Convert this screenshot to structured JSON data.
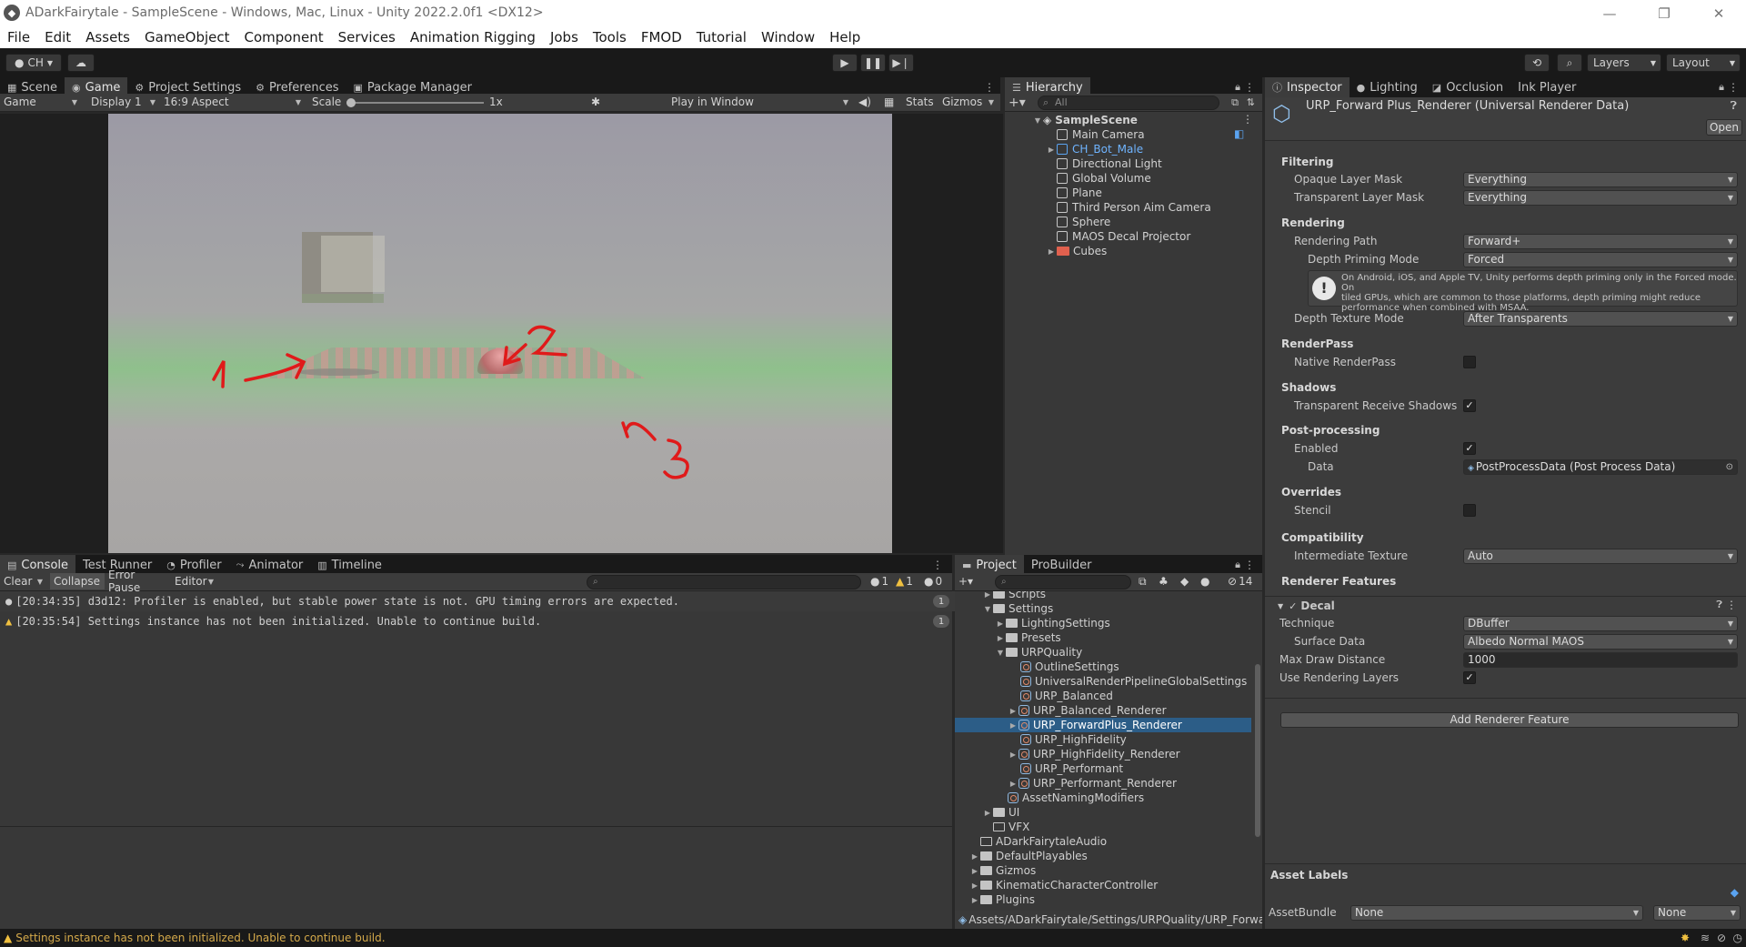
{
  "window": {
    "title": "ADarkFairytale - SampleScene - Windows, Mac, Linux - Unity 2022.2.0f1 <DX12>",
    "controls": [
      "—",
      "❐",
      "✕"
    ]
  },
  "menu": [
    "File",
    "Edit",
    "Assets",
    "GameObject",
    "Component",
    "Services",
    "Animation Rigging",
    "Jobs",
    "Tools",
    "FMOD",
    "Tutorial",
    "Window",
    "Help"
  ],
  "toolbar": {
    "account": "CH",
    "layers": "Layers",
    "layout": "Layout"
  },
  "left_tabs": [
    "Scene",
    "Game",
    "Project Settings",
    "Preferences",
    "Package Manager"
  ],
  "game_toolbar": {
    "mode": "Game",
    "display": "Display 1",
    "aspect": "16:9 Aspect",
    "scale_label": "Scale",
    "scale_value": "1x",
    "play_mode": "Play in Window",
    "stats": "Stats",
    "gizmos": "Gizmos"
  },
  "annotations": [
    "1",
    "2",
    "3"
  ],
  "hierarchy": {
    "tab": "Hierarchy",
    "search_placeholder": "All",
    "scene": "SampleScene",
    "items": [
      "Main Camera",
      "CH_Bot_Male",
      "Directional Light",
      "Global Volume",
      "Plane",
      "Third Person Aim Camera",
      "Sphere",
      "MAOS Decal Projector",
      "Cubes"
    ]
  },
  "inspector": {
    "tabs": [
      "Inspector",
      "Lighting",
      "Occlusion",
      "Ink Player"
    ],
    "title": "URP_Forward Plus_Renderer (Universal Renderer Data)",
    "open_button": "Open",
    "filtering": "Filtering",
    "opaque_label": "Opaque Layer Mask",
    "opaque_value": "Everything",
    "transparent_label": "Transparent Layer Mask",
    "transparent_value": "Everything",
    "rendering": "Rendering",
    "rendering_path_label": "Rendering Path",
    "rendering_path_value": "Forward+",
    "depth_priming_label": "Depth Priming Mode",
    "depth_priming_value": "Forced",
    "info_line1": "On Android, iOS, and Apple TV, Unity performs depth priming only in the Forced mode. On",
    "info_line2": "tiled GPUs, which are common to those platforms, depth priming might reduce",
    "info_line3": "performance when combined with MSAA.",
    "depth_texture_label": "Depth Texture Mode",
    "depth_texture_value": "After Transparents",
    "renderpass": "RenderPass",
    "native_renderpass": "Native RenderPass",
    "shadows": "Shadows",
    "transparent_receive": "Transparent Receive Shadows",
    "post_processing": "Post-processing",
    "enabled": "Enabled",
    "data_label": "Data",
    "data_value": "PostProcessData (Post Process Data)",
    "overrides": "Overrides",
    "stencil": "Stencil",
    "compatibility": "Compatibility",
    "intermediate_label": "Intermediate Texture",
    "intermediate_value": "Auto",
    "renderer_features": "Renderer Features",
    "decal": "Decal",
    "technique_label": "Technique",
    "technique_value": "DBuffer",
    "surface_label": "Surface Data",
    "surface_value": "Albedo Normal MAOS",
    "max_draw_label": "Max Draw Distance",
    "max_draw_value": "1000",
    "use_layers_label": "Use Rendering Layers",
    "add_feature": "Add Renderer Feature",
    "asset_labels": "Asset Labels",
    "assetbundle_label": "AssetBundle",
    "assetbundle_value": "None",
    "variant_value": "None"
  },
  "console": {
    "tabs": [
      "Console",
      "Test Runner",
      "Profiler",
      "Animator",
      "Timeline"
    ],
    "clear": "Clear",
    "collapse": "Collapse",
    "error_pause": "Error Pause",
    "editor": "Editor",
    "count_info": "1",
    "count_warn": "1",
    "count_err": "0",
    "logs": [
      {
        "text": "[20:34:35] d3d12: Profiler is enabled, but stable power state is not. GPU timing errors are expected.",
        "count": "1"
      },
      {
        "text": "[20:35:54] Settings instance has not been initialized. Unable to continue build.",
        "count": "1"
      }
    ]
  },
  "project": {
    "tabs": [
      "Project",
      "ProBuilder"
    ],
    "hidden_count": "14",
    "items": [
      "Scripts",
      "Settings",
      "LightingSettings",
      "Presets",
      "URPQuality",
      "OutlineSettings",
      "UniversalRenderPipelineGlobalSettings",
      "URP_Balanced",
      "URP_Balanced_Renderer",
      "URP_ForwardPlus_Renderer",
      "URP_HighFidelity",
      "URP_HighFidelity_Renderer",
      "URP_Performant",
      "URP_Performant_Renderer",
      "AssetNamingModifiers",
      "UI",
      "VFX",
      "ADarkFairytaleAudio",
      "DefaultPlayables",
      "Gizmos",
      "KinematicCharacterController",
      "Plugins"
    ],
    "path": "Assets/ADarkFairytale/Settings/URPQuality/URP_Forwa"
  },
  "status": "Settings instance has not been initialized. Unable to continue build."
}
